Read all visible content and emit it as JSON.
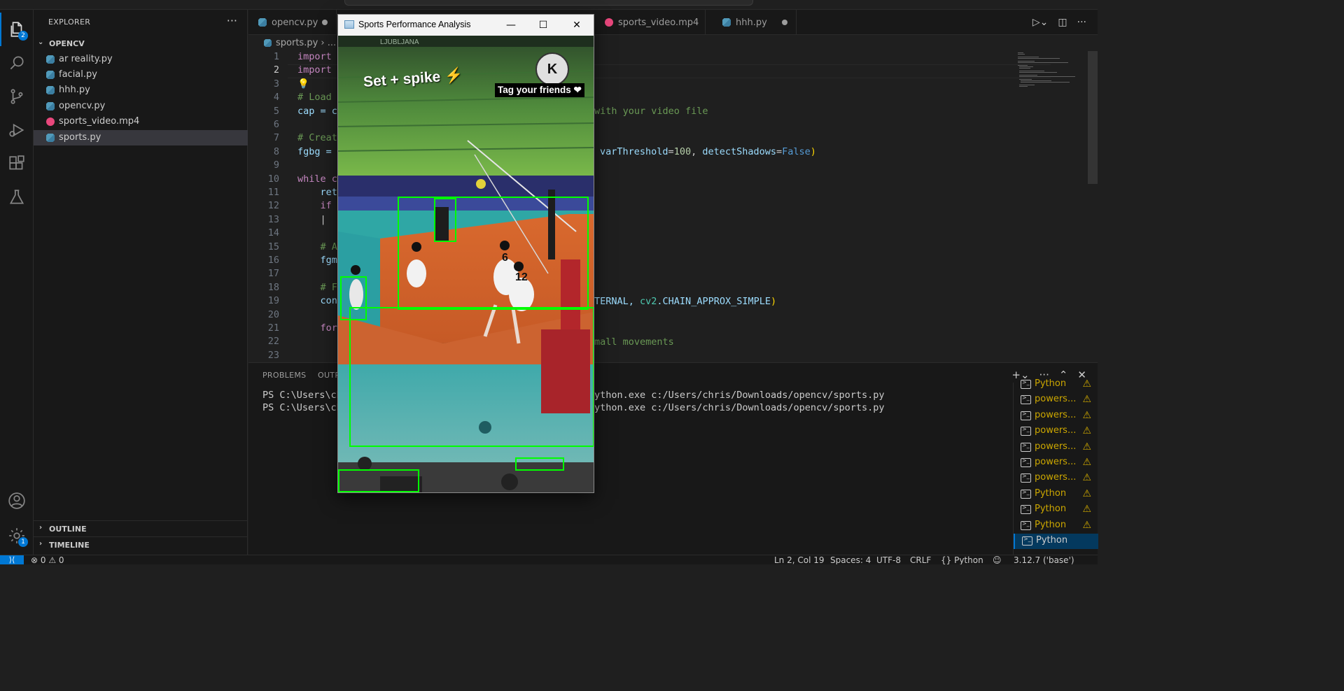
{
  "explorer": {
    "header": "EXPLORER",
    "more": "···",
    "folder": "OPENCV",
    "files": [
      {
        "name": "ar reality.py",
        "type": "py"
      },
      {
        "name": "facial.py",
        "type": "py"
      },
      {
        "name": "hhh.py",
        "type": "py"
      },
      {
        "name": "opencv.py",
        "type": "py"
      },
      {
        "name": "sports_video.mp4",
        "type": "mp4"
      },
      {
        "name": "sports.py",
        "type": "py",
        "selected": true
      }
    ],
    "outline": "OUTLINE",
    "timeline": "TIMELINE"
  },
  "activity": {
    "explorer_badge": "2",
    "settings_badge": "1"
  },
  "tabs": [
    {
      "label": "opencv.py",
      "dirty": true
    },
    {
      "label": "sports_video.mp4",
      "dirty": false
    },
    {
      "label": "hhh.py",
      "dirty": true
    }
  ],
  "breadcrumb": {
    "file": "sports.py",
    "sep": "›",
    "rest": "..."
  },
  "editor": {
    "lines": [
      {
        "n": "1",
        "code": "import c"
      },
      {
        "n": "2",
        "code": "import n"
      },
      {
        "n": "3",
        "code": "💡"
      },
      {
        "n": "4",
        "code": "# Load t"
      },
      {
        "n": "5",
        "code": "cap = cv"
      },
      {
        "n": "6",
        "code": ""
      },
      {
        "n": "7",
        "code": "# Create"
      },
      {
        "n": "8",
        "code": "fgbg = c"
      },
      {
        "n": "9",
        "code": ""
      },
      {
        "n": "10",
        "code": "while ca"
      },
      {
        "n": "11",
        "code": "    ret"
      },
      {
        "n": "12",
        "code": "    if "
      },
      {
        "n": "13",
        "code": "    |"
      },
      {
        "n": "14",
        "code": ""
      },
      {
        "n": "15",
        "code": "    # A"
      },
      {
        "n": "16",
        "code": "    fgm"
      },
      {
        "n": "17",
        "code": ""
      },
      {
        "n": "18",
        "code": "    # F"
      },
      {
        "n": "19",
        "code": "    con"
      },
      {
        "n": "20",
        "code": ""
      },
      {
        "n": "21",
        "code": "    for"
      },
      {
        "n": "22",
        "code": ""
      },
      {
        "n": "23",
        "code": ""
      }
    ],
    "right_fragments": {
      "line5": "with your video file",
      "line8_a": "varThreshold",
      "line8_b": "=",
      "line8_c": "100",
      "line8_d": ", ",
      "line8_e": "detectShadows",
      "line8_f": "=",
      "line8_g": "False",
      "line8_h": ")",
      "line19_a": "TERNAL, ",
      "line19_b": "cv2",
      "line19_c": ".CHAIN_APPROX_SIMPLE",
      "line19_d": ")",
      "line22": "mall movements"
    }
  },
  "panel": {
    "tabs": [
      "PROBLEMS",
      "OUTP"
    ],
    "terminal_left": [
      "PS C:\\Users\\chr",
      "PS C:\\Users\\chr"
    ],
    "terminal_right": [
      "ython.exe c:/Users/chris/Downloads/opencv/sports.py",
      "ython.exe c:/Users/chris/Downloads/opencv/sports.py"
    ],
    "terminals": [
      {
        "name": "Python",
        "warn": true
      },
      {
        "name": "powers...",
        "warn": true
      },
      {
        "name": "powers...",
        "warn": true
      },
      {
        "name": "powers...",
        "warn": true
      },
      {
        "name": "powers...",
        "warn": true
      },
      {
        "name": "powers...",
        "warn": true
      },
      {
        "name": "powers...",
        "warn": true
      },
      {
        "name": "Python",
        "warn": true
      },
      {
        "name": "Python",
        "warn": true
      },
      {
        "name": "Python",
        "warn": true
      },
      {
        "name": "Python",
        "warn": false,
        "selected": true
      }
    ]
  },
  "status": {
    "errors": "0",
    "warnings": "0",
    "position": "Ln 2, Col 19",
    "spaces": "Spaces: 4",
    "encoding": "UTF-8",
    "eol": "CRLF",
    "language": "Python",
    "interpreter": "3.12.7 ('base')"
  },
  "cv_window": {
    "title": "Sports Performance Analysis",
    "minimize": "—",
    "maximize": "☐",
    "close": "✕",
    "overlay_text": "Set + spike ⚡",
    "tag_text": "Tag your friends ❤",
    "logo_letter": "K",
    "banner_text": "LJUBLJANA",
    "jersey_numbers": [
      "6",
      "12"
    ]
  },
  "colors": {
    "accent": "#0078d4",
    "detection_box": "#00ff00",
    "warning": "#cca700"
  }
}
